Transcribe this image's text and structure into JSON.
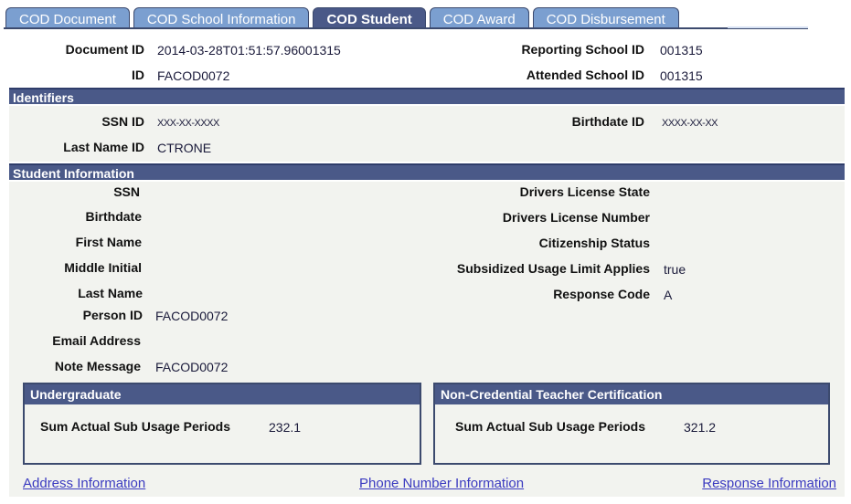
{
  "tabs": [
    {
      "label": "COD Document",
      "active": false
    },
    {
      "label": "COD School Information",
      "active": false
    },
    {
      "label": "COD Student",
      "active": true
    },
    {
      "label": "COD Award",
      "active": false
    },
    {
      "label": "COD Disbursement",
      "active": false
    }
  ],
  "header": {
    "document_id": {
      "label": "Document ID",
      "value": "2014-03-28T01:51:57.96001315"
    },
    "id": {
      "label": "ID",
      "value": "FACOD0072"
    },
    "reporting_school_id": {
      "label": "Reporting School ID",
      "value": "001315"
    },
    "attended_school_id": {
      "label": "Attended School ID",
      "value": "001315"
    }
  },
  "identifiers": {
    "title": "Identifiers",
    "ssn_id": {
      "label": "SSN ID",
      "value": "XXX-XX-XXXX"
    },
    "birthdate_id": {
      "label": "Birthdate ID",
      "value": "XXXX-XX-XX"
    },
    "last_name_id": {
      "label": "Last Name ID",
      "value": "CTRONE"
    }
  },
  "student_information": {
    "title": "Student Information",
    "left": [
      {
        "label": "SSN",
        "value": ""
      },
      {
        "label": "Birthdate",
        "value": ""
      },
      {
        "label": "First Name",
        "value": ""
      },
      {
        "label": "Middle Initial",
        "value": ""
      },
      {
        "label": "Last Name",
        "value": ""
      },
      {
        "label": "Person ID",
        "value": "FACOD0072"
      },
      {
        "label": "Email Address",
        "value": ""
      },
      {
        "label": "Note Message",
        "value": "FACOD0072"
      }
    ],
    "right": [
      {
        "label": "Drivers License State",
        "value": ""
      },
      {
        "label": "Drivers License Number",
        "value": ""
      },
      {
        "label": "Citizenship Status",
        "value": ""
      },
      {
        "label": "Subsidized Usage Limit Applies",
        "value": "true"
      },
      {
        "label": "Response Code",
        "value": "A"
      }
    ]
  },
  "undergraduate": {
    "title": "Undergraduate",
    "label": "Sum Actual Sub Usage Periods",
    "value": "232.1"
  },
  "teacher_cert": {
    "title": "Non-Credential Teacher Certification",
    "label": "Sum Actual Sub Usage Periods",
    "value": "321.2"
  },
  "links": {
    "address": "Address Information",
    "phone": "Phone Number Information",
    "response": "Response Information"
  },
  "colors": {
    "tab_inactive": "#7b9fd0",
    "tab_active": "#4a5988",
    "section_bar": "#4a5988",
    "panel_bg": "#f2f3ef",
    "link": "#3a3ac0"
  }
}
